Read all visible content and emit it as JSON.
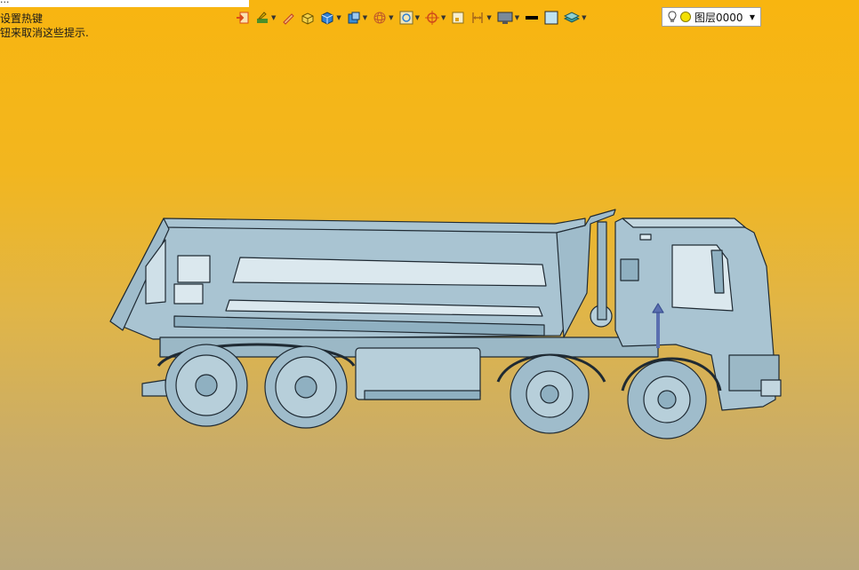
{
  "window": {
    "title_fragment": "..."
  },
  "hints": {
    "line1": "设置热键",
    "line2": "钮来取消这些提示."
  },
  "toolbar": {
    "buttons": [
      {
        "name": "exit-icon",
        "color": "#d94a1a"
      },
      {
        "name": "pen-layers-icon",
        "color": "#4a8f2a"
      },
      {
        "name": "pencil-icon",
        "color": "#c0392b"
      },
      {
        "name": "box-yellow-icon",
        "color": "#e0b400"
      },
      {
        "name": "cube-blue-icon",
        "color": "#2e7fd3"
      },
      {
        "name": "cube-views-icon",
        "color": "#3a8dd6"
      },
      {
        "name": "sphere-wire-icon",
        "color": "#c05a2a"
      },
      {
        "name": "fit-view-icon",
        "color": "#7a6a2a"
      },
      {
        "name": "crosshair-icon",
        "color": "#d04a1a"
      },
      {
        "name": "frame-icon",
        "color": "#8a6d1a"
      },
      {
        "name": "dimension-icon",
        "color": "#a86a1a"
      },
      {
        "name": "monitor-icon",
        "color": "#555555"
      },
      {
        "name": "line-color-icon",
        "color": "#000000"
      },
      {
        "name": "fill-color-icon",
        "color": "#bfe3f2"
      },
      {
        "name": "layers-icon",
        "color": "#3aa0a0"
      }
    ]
  },
  "layer": {
    "name": "图层0000",
    "bulb_color": "#f3e000"
  },
  "colors": {
    "background_top": "#f8b510",
    "background_bottom": "#b9a77a",
    "model": "#a9c4d2",
    "model_stroke": "#1f2a33"
  }
}
